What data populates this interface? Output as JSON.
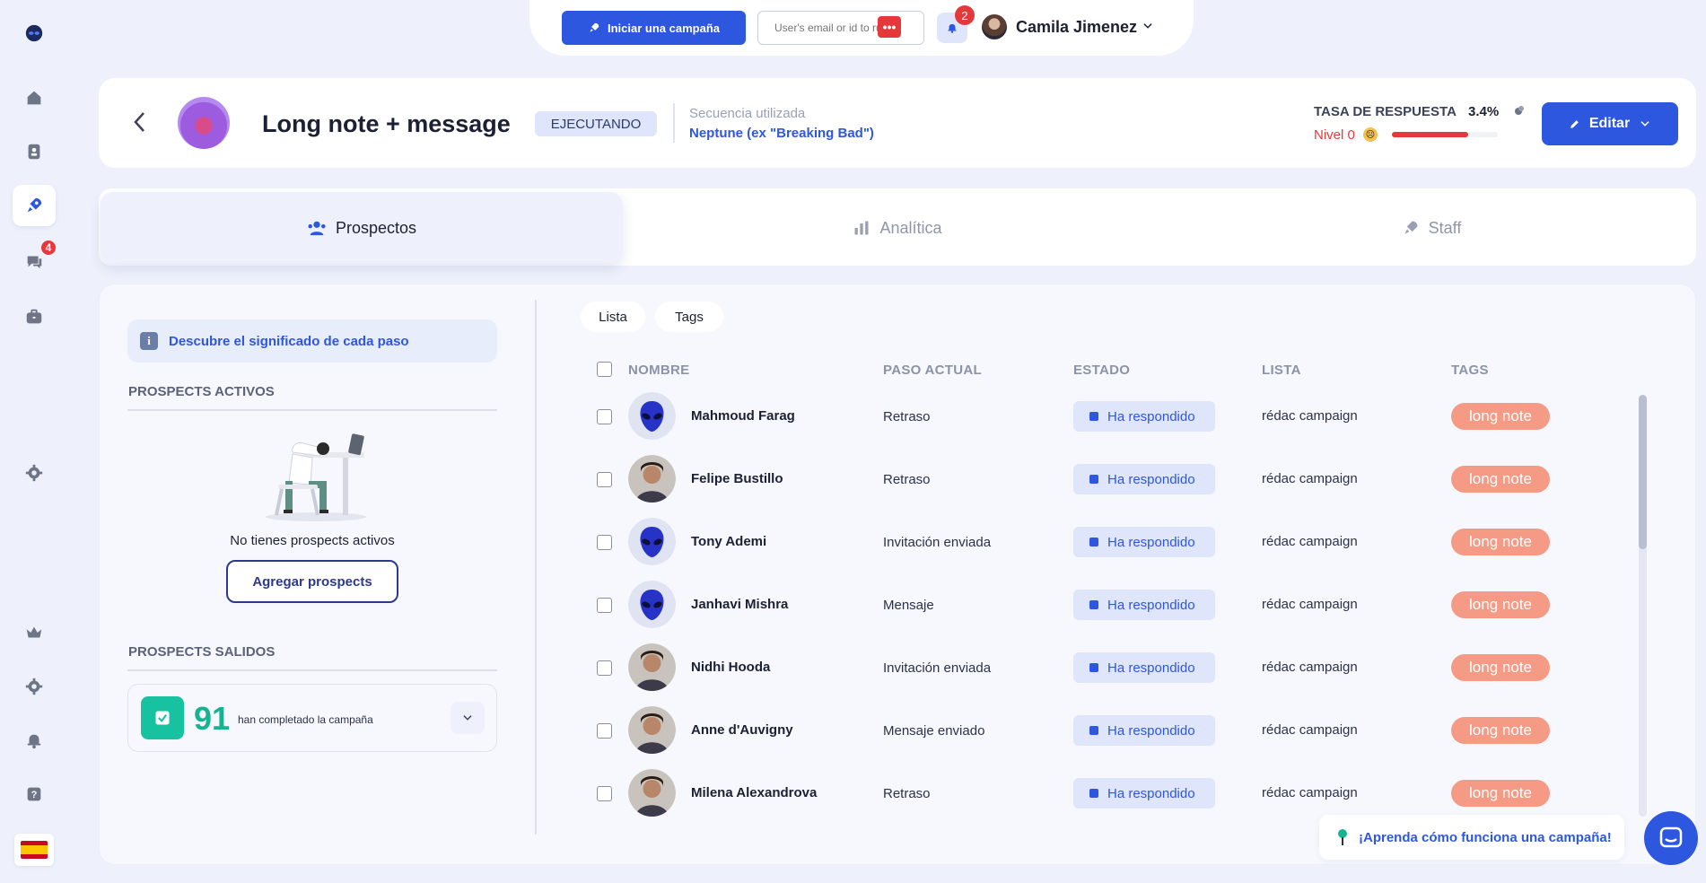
{
  "topbar": {
    "launch_button": "Iniciar una campaña",
    "search_placeholder": "User's email or id to run",
    "notifications_count": "2",
    "user_name": "Camila Jimenez"
  },
  "sidebar": {
    "messages_badge": "4"
  },
  "campaign": {
    "title": "Long note + message",
    "status": "EJECUTANDO",
    "sequence_label": "Secuencia utilizada",
    "sequence_value": "Neptune (ex \"Breaking Bad\")",
    "rate_label": "TASA DE RESPUESTA",
    "rate_value": "3.4%",
    "level_label": "Nivel 0",
    "level_progress": 0.72,
    "edit_button": "Editar"
  },
  "tabs": [
    {
      "label": "Prospectos"
    },
    {
      "label": "Analítica"
    },
    {
      "label": "Staff"
    }
  ],
  "left_panel": {
    "info_banner": "Descubre el significado de cada paso",
    "active_title": "PROSPECTS ACTIVOS",
    "empty_text": "No tienes prospects activos",
    "add_button": "Agregar prospects",
    "exited_title": "PROSPECTS SALIDOS",
    "completed_count": "91",
    "completed_label": "han completado la campaña"
  },
  "view_tabs": [
    "Lista",
    "Tags"
  ],
  "table": {
    "headers": [
      "NOMBRE",
      "PASO ACTUAL",
      "ESTADO",
      "LISTA",
      "TAGS"
    ],
    "rows": [
      {
        "name": "Mahmoud Farag",
        "step": "Retraso",
        "state": "Ha respondido",
        "list": "rédac campaign",
        "tag": "long note",
        "avatar": "alien"
      },
      {
        "name": "Felipe Bustillo",
        "step": "Retraso",
        "state": "Ha respondido",
        "list": "rédac campaign",
        "tag": "long note",
        "avatar": "photo"
      },
      {
        "name": "Tony Ademi",
        "step": "Invitación enviada",
        "state": "Ha respondido",
        "list": "rédac campaign",
        "tag": "long note",
        "avatar": "alien"
      },
      {
        "name": "Janhavi Mishra",
        "step": "Mensaje",
        "state": "Ha respondido",
        "list": "rédac campaign",
        "tag": "long note",
        "avatar": "alien"
      },
      {
        "name": "Nidhi Hooda",
        "step": "Invitación enviada",
        "state": "Ha respondido",
        "list": "rédac campaign",
        "tag": "long note",
        "avatar": "photo"
      },
      {
        "name": "Anne d'Auvigny",
        "step": "Mensaje enviado",
        "state": "Ha respondido",
        "list": "rédac campaign",
        "tag": "long note",
        "avatar": "photo"
      },
      {
        "name": "Milena Alexandrova",
        "step": "Retraso",
        "state": "Ha respondido",
        "list": "rédac campaign",
        "tag": "long note",
        "avatar": "photo"
      }
    ]
  },
  "help": {
    "learn_text": "¡Aprenda cómo funciona una campaña!"
  },
  "colors": {
    "primary": "#2e57df",
    "danger": "#e5383b",
    "success": "#17c2a1",
    "tag": "#f49a85"
  }
}
